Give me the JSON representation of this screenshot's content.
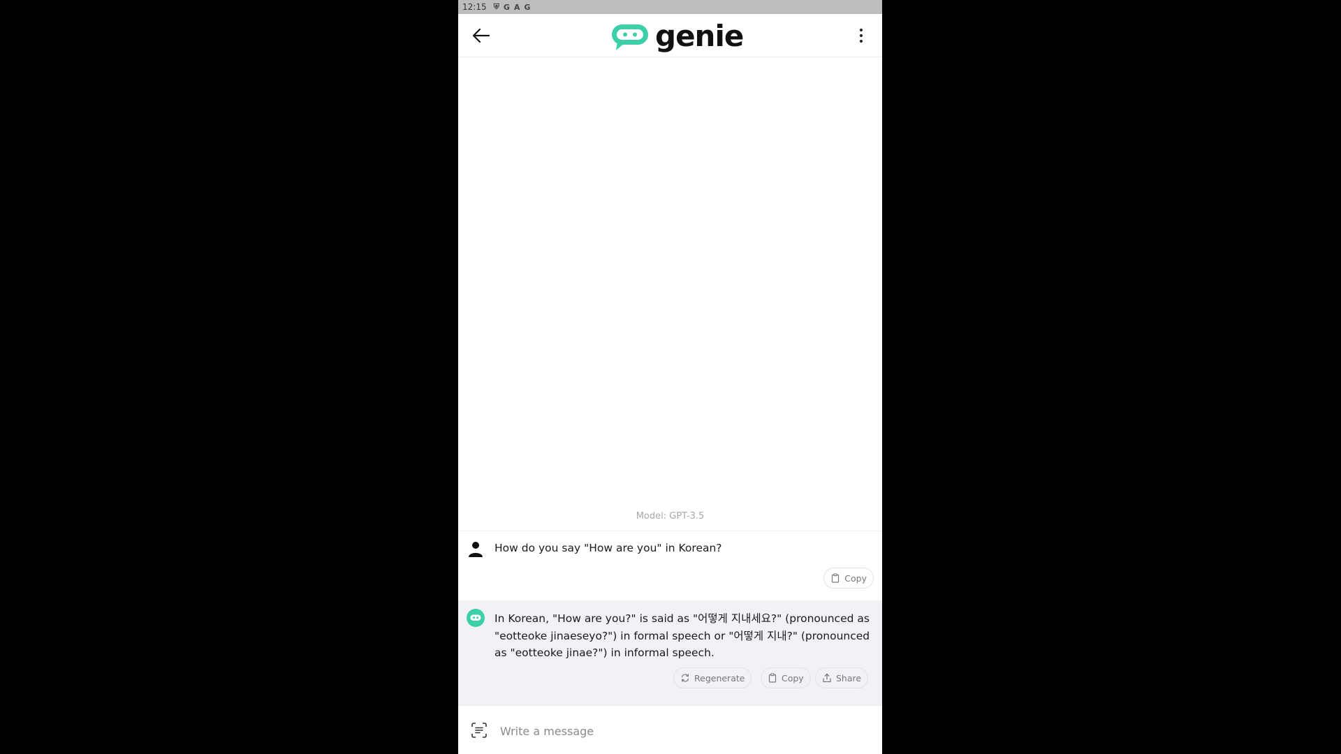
{
  "status_bar": {
    "time": "12:15",
    "icons": [
      "shield-icon",
      "google-icon",
      "a-icon",
      "google-icon"
    ],
    "icon_glyphs": [
      "⛨",
      "G",
      "A",
      "G"
    ]
  },
  "header": {
    "brand": "genie",
    "brand_color": "#3ccfa8"
  },
  "chat": {
    "model_label": "Model: GPT-3.5",
    "messages": [
      {
        "role": "user",
        "text": "How do you say \"How are you\" in Korean?",
        "actions": [
          "Copy"
        ]
      },
      {
        "role": "assistant",
        "text": "In Korean, \"How are you?\" is said as \"어떻게 지내세요?\" (pronounced as \"eotteoke jinaeseyo?\") in formal speech or \"어떻게 지내?\" (pronounced as \"eotteoke jinae?\") in informal speech.",
        "actions": [
          "Regenerate",
          "Copy",
          "Share"
        ]
      }
    ]
  },
  "composer": {
    "placeholder": "Write a message",
    "value": ""
  }
}
